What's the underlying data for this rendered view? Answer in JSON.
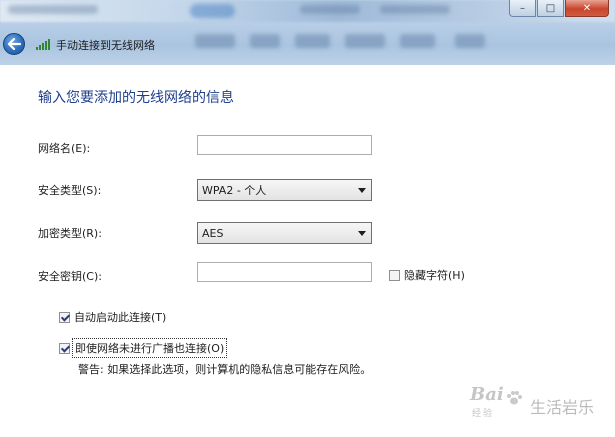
{
  "window": {
    "title": "手动连接到无线网络",
    "close_symbol": "✕",
    "maximize_symbol": "□",
    "minimize_symbol": "–"
  },
  "form": {
    "heading": "输入您要添加的无线网络的信息",
    "network_name": {
      "label": "网络名(E):",
      "value": ""
    },
    "security_type": {
      "label": "安全类型(S):",
      "value": "WPA2 - 个人"
    },
    "encryption_type": {
      "label": "加密类型(R):",
      "value": "AES"
    },
    "security_key": {
      "label": "安全密钥(C):",
      "value": ""
    },
    "hide_chars": {
      "label": "隐藏字符(H)",
      "checked": false
    },
    "auto_connect": {
      "label": "自动启动此连接(T)",
      "checked": true
    },
    "connect_hidden": {
      "label": "即使网络未进行广播也连接(O)",
      "checked": true
    },
    "warning": "警告: 如果选择此选项，则计算机的隐私信息可能存在风险。"
  },
  "watermark": {
    "brand": "Bai",
    "suffix": "经验",
    "side_text": "生活岩乐"
  },
  "colors": {
    "heading": "#1e3f8c",
    "glass": "#b6cde6"
  }
}
